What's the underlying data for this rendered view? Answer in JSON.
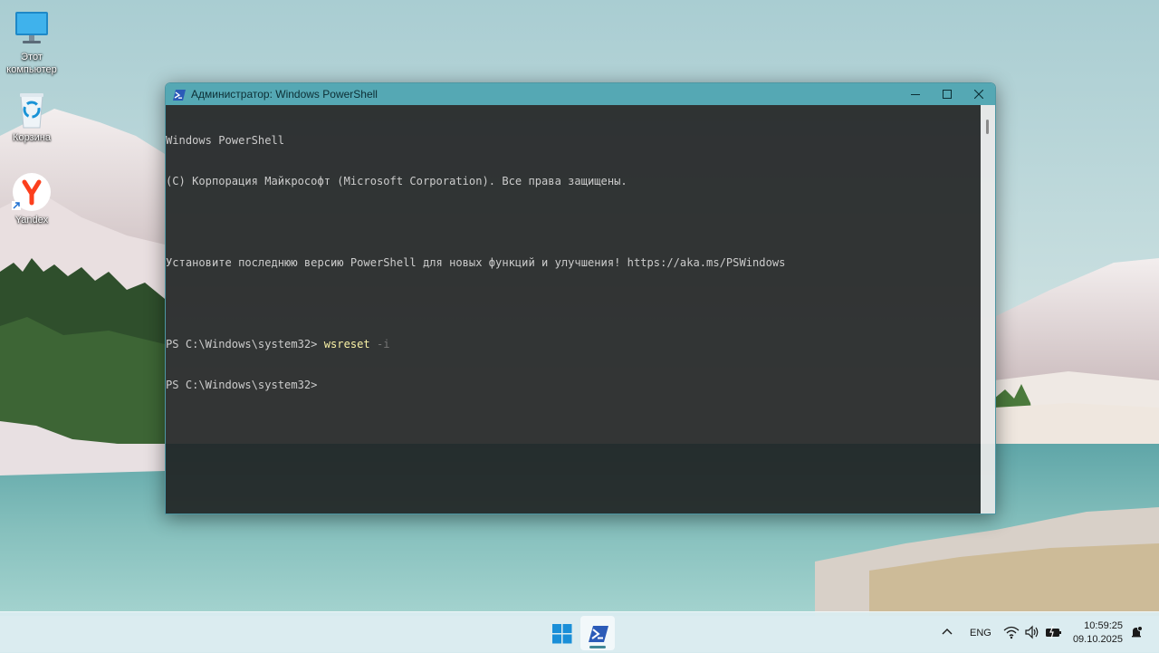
{
  "desktop": {
    "icons": [
      {
        "label": "Этот компьютер",
        "icon": "monitor-icon"
      },
      {
        "label": "Корзина",
        "icon": "recycle-bin-icon"
      },
      {
        "label": "Yandex",
        "icon": "yandex-browser-icon"
      }
    ]
  },
  "window": {
    "title": "Администратор: Windows PowerShell",
    "icon": "powershell-icon",
    "controls": {
      "minimize": "minimize-icon",
      "maximize": "maximize-icon",
      "close": "close-icon"
    },
    "console": {
      "lines": [
        "Windows PowerShell",
        "(C) Корпорация Майкрософт (Microsoft Corporation). Все права защищены.",
        "",
        "Установите последнюю версию PowerShell для новых функций и улучшения! https://aka.ms/PSWindows",
        ""
      ],
      "prompt1": "PS C:\\Windows\\system32> ",
      "command": "wsreset",
      "argument": " -i",
      "prompt2": "PS C:\\Windows\\system32>"
    }
  },
  "taskbar": {
    "buttons": [
      {
        "name": "start-button",
        "icon": "windows-logo-icon"
      },
      {
        "name": "taskbar-powershell-button",
        "icon": "powershell-icon",
        "active": true
      }
    ],
    "tray": {
      "language": "ENG",
      "icons": [
        "chevron-up-icon",
        "wifi-icon",
        "volume-icon",
        "battery-icon",
        "notification-icon"
      ]
    },
    "clock": {
      "time": "10:59:25",
      "date": "09.10.2025"
    }
  },
  "colors": {
    "titlebar": "#55a8b4",
    "console_bg": "#1c1c1c",
    "console_text": "#cccccc",
    "command": "#f9f1a5",
    "argument": "#767676"
  }
}
